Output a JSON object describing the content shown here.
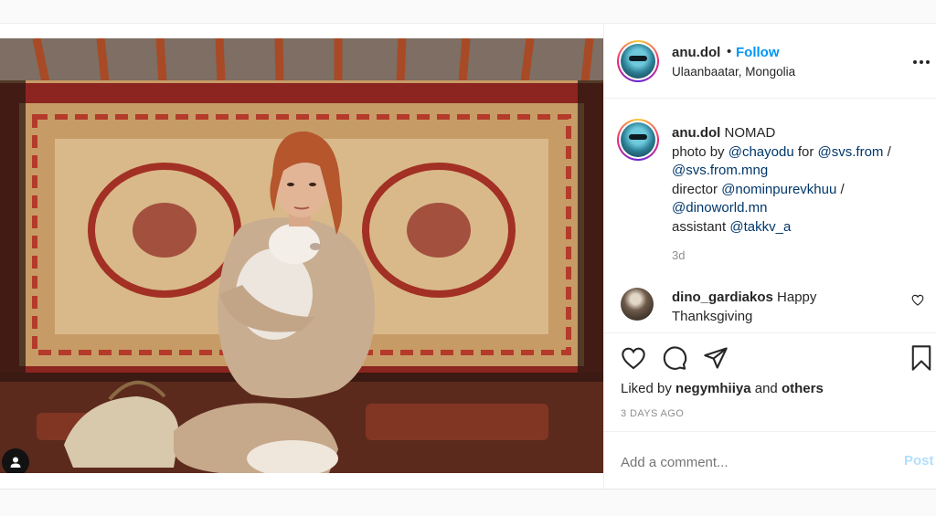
{
  "post": {
    "author": {
      "username": "anu.dol",
      "separator": "•",
      "follow_label": "Follow",
      "location": "Ulaanbaatar, Mongolia"
    },
    "photo": {
      "icon": "user-tag-icon"
    },
    "caption": {
      "username": "anu.dol",
      "title": "NOMAD",
      "line1_prefix": "photo by ",
      "line1_mention1": "@chayodu",
      "line1_mid": " for ",
      "line1_mention2": "@svs.from",
      "line1_suffix": " /",
      "line2_mention": "@svs.from.mng",
      "line3_prefix": "director ",
      "line3_mention": "@nominpurevkhuu",
      "line3_suffix": " /",
      "line4_mention": "@dinoworld.mn",
      "line5_prefix": "assistant ",
      "line5_mention": "@takkv_a",
      "age": "3d"
    },
    "comments": [
      {
        "username": "dino_gardiakos",
        "text": " Happy Thanksgiving"
      }
    ],
    "actions": {
      "like_icon": "heart-icon",
      "comment_icon": "comment-icon",
      "share_icon": "share-icon",
      "save_icon": "bookmark-icon"
    },
    "likes": {
      "prefix": "Liked by ",
      "user": "negymhiiya",
      "middle": " and ",
      "others": "others"
    },
    "date": "3 DAYS AGO",
    "add_comment": {
      "placeholder": "Add a comment...",
      "post_label": "Post"
    },
    "colors": {
      "link": "#0095f6",
      "mention": "#00376b",
      "muted": "#8e8e8e",
      "post_disabled": "#b2dffc"
    }
  }
}
